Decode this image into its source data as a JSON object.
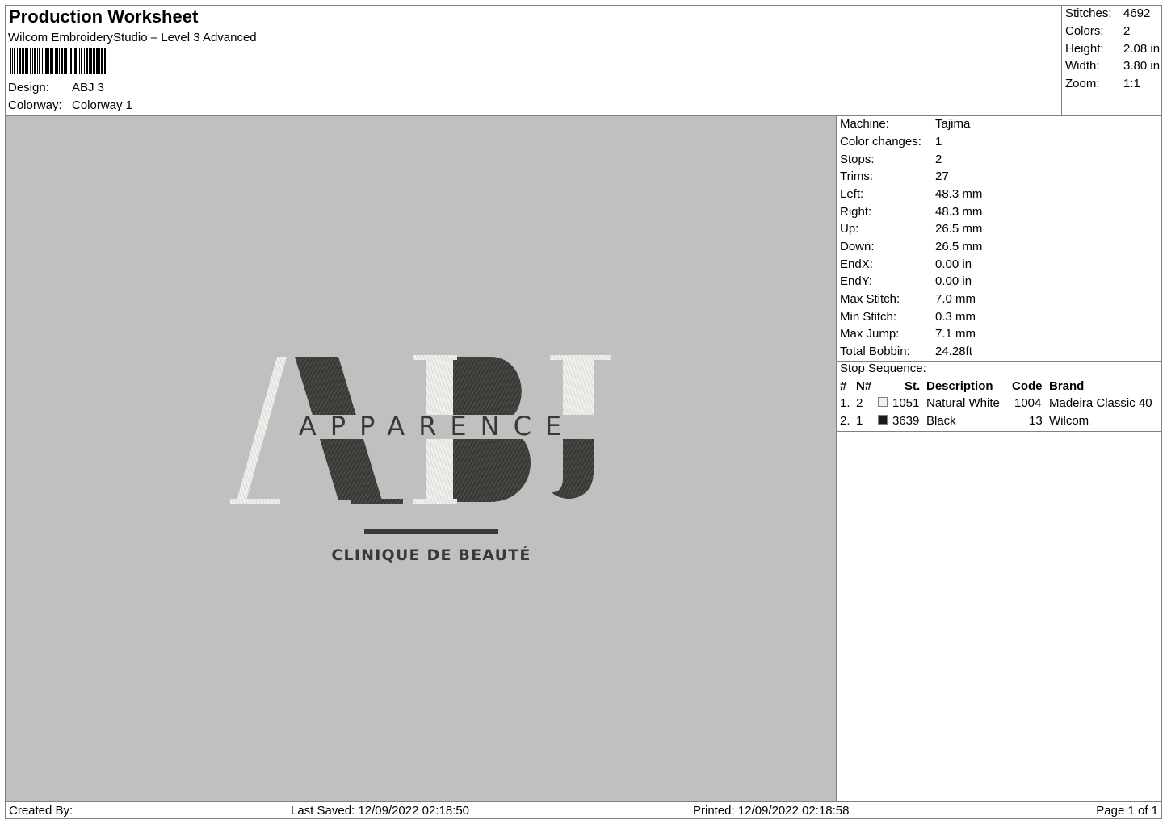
{
  "header": {
    "title": "Production Worksheet",
    "software": "Wilcom EmbroideryStudio – Level 3 Advanced",
    "design_label": "Design:",
    "design_value": "ABJ 3",
    "colorway_label": "Colorway:",
    "colorway_value": "Colorway 1"
  },
  "summary": [
    {
      "label": "Stitches:",
      "value": "4692"
    },
    {
      "label": "Colors:",
      "value": "2"
    },
    {
      "label": "Height:",
      "value": "2.08 in"
    },
    {
      "label": "Width:",
      "value": "3.80 in"
    },
    {
      "label": "Zoom:",
      "value": "1:1"
    }
  ],
  "machine_info": [
    {
      "label": "Machine:",
      "value": "Tajima"
    },
    {
      "label": "Color changes:",
      "value": "1"
    },
    {
      "label": "Stops:",
      "value": "2"
    },
    {
      "label": "Trims:",
      "value": "27"
    },
    {
      "label": "Left:",
      "value": "48.3 mm"
    },
    {
      "label": "Right:",
      "value": "48.3 mm"
    },
    {
      "label": "Up:",
      "value": "26.5 mm"
    },
    {
      "label": "Down:",
      "value": "26.5 mm"
    },
    {
      "label": "EndX:",
      "value": "0.00 in"
    },
    {
      "label": "EndY:",
      "value": "0.00 in"
    },
    {
      "label": "Max Stitch:",
      "value": "7.0 mm"
    },
    {
      "label": "Min Stitch:",
      "value": "0.3 mm"
    },
    {
      "label": "Max Jump:",
      "value": "7.1 mm"
    },
    {
      "label": "Total Bobbin:",
      "value": "24.28ft"
    }
  ],
  "stop_sequence": {
    "label": "Stop Sequence:",
    "headers": {
      "idx": "#",
      "n": "N#",
      "st": "St.",
      "desc": "Description",
      "code": "Code",
      "brand": "Brand"
    },
    "rows": [
      {
        "idx": "1.",
        "n": "2",
        "swatch": "#f2f2f2",
        "st": "1051",
        "desc": "Natural White",
        "code": "1004",
        "brand": "Madeira Classic 40"
      },
      {
        "idx": "2.",
        "n": "1",
        "swatch": "#1a1a1a",
        "st": "3639",
        "desc": "Black",
        "code": "13",
        "brand": "Wilcom"
      }
    ]
  },
  "design": {
    "monogram": "ABJ",
    "wordmark": "APPARENCE",
    "tagline": "CLINIQUE DE BEAUTÉ",
    "thread_dark": "#3a3935",
    "thread_light": "#eef0ec",
    "background": "#c0c0c0"
  },
  "footer": {
    "created_by": "Created By:",
    "last_saved": "Last Saved: 12/09/2022 02:18:50",
    "printed": "Printed: 12/09/2022 02:18:58",
    "page": "Page 1 of 1"
  }
}
